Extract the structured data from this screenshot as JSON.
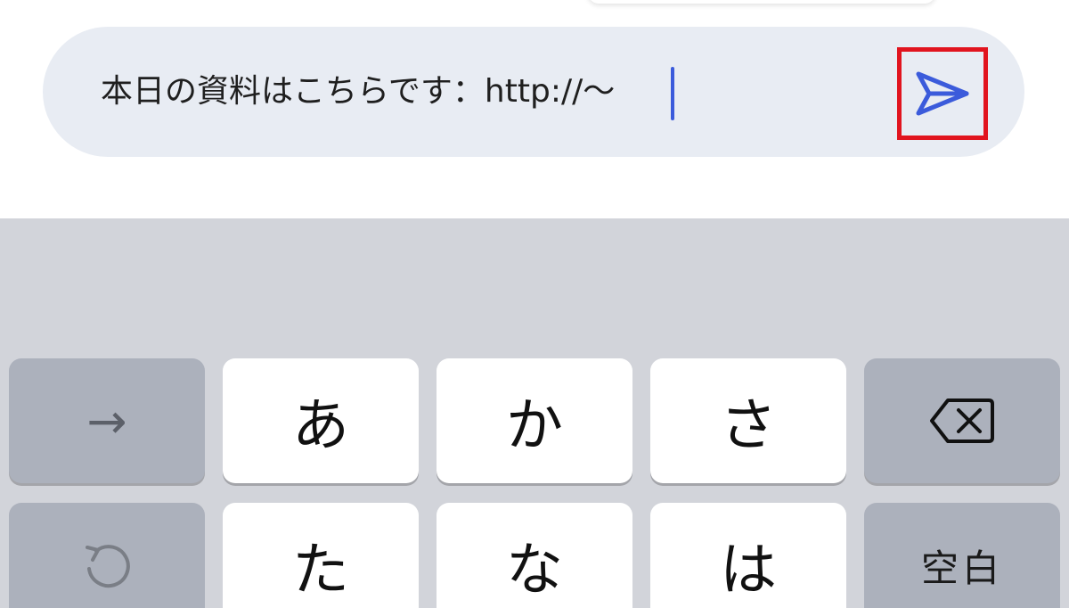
{
  "compose": {
    "message_text": "本日の資料はこちらです：http://〜",
    "send_icon": "send-arrow-icon",
    "accent_color": "#3b5bdb",
    "highlight_color": "#e1141e"
  },
  "keyboard": {
    "row1": {
      "next_key_glyph": "→",
      "keys": [
        "あ",
        "か",
        "さ"
      ],
      "backspace_icon": "backspace-icon"
    },
    "row2": {
      "undo_icon": "undo-icon",
      "keys": [
        "た",
        "な",
        "は"
      ],
      "space_label": "空白"
    }
  }
}
